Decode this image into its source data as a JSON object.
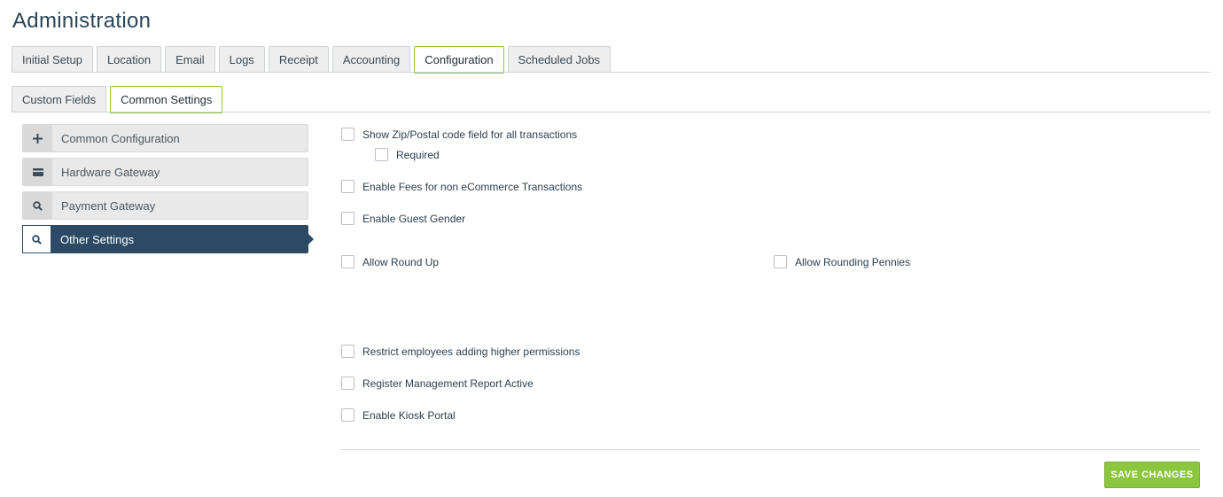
{
  "page": {
    "title": "Administration"
  },
  "main_tabs": [
    {
      "label": "Initial Setup",
      "active": false
    },
    {
      "label": "Location",
      "active": false
    },
    {
      "label": "Email",
      "active": false
    },
    {
      "label": "Logs",
      "active": false
    },
    {
      "label": "Receipt",
      "active": false
    },
    {
      "label": "Accounting",
      "active": false
    },
    {
      "label": "Configuration",
      "active": true
    },
    {
      "label": "Scheduled Jobs",
      "active": false
    }
  ],
  "sub_tabs": [
    {
      "label": "Custom Fields",
      "active": false
    },
    {
      "label": "Common Settings",
      "active": true
    }
  ],
  "side_nav": [
    {
      "label": "Common Configuration",
      "icon": "plus-icon",
      "active": false
    },
    {
      "label": "Hardware Gateway",
      "icon": "card-icon",
      "active": false
    },
    {
      "label": "Payment Gateway",
      "icon": "search-icon",
      "active": false
    },
    {
      "label": "Other Settings",
      "icon": "search-icon",
      "active": true
    }
  ],
  "settings": {
    "show_zip": {
      "label": "Show Zip/Postal code field for all transactions",
      "checked": false
    },
    "required": {
      "label": "Required",
      "checked": false
    },
    "enable_fees": {
      "label": "Enable Fees for non eCommerce Transactions",
      "checked": false
    },
    "guest_gender": {
      "label": "Enable Guest Gender",
      "checked": false
    },
    "round_up": {
      "label": "Allow Round Up",
      "checked": false
    },
    "rounding_pennies": {
      "label": "Allow Rounding Pennies",
      "checked": false
    },
    "restrict_permissions": {
      "label": "Restrict employees adding higher permissions",
      "checked": false
    },
    "register_report": {
      "label": "Register Management Report Active",
      "checked": false
    },
    "kiosk_portal": {
      "label": "Enable Kiosk Portal",
      "checked": false
    }
  },
  "actions": {
    "save_label": "SAVE CHANGES"
  },
  "colors": {
    "accent": "#8cc63f",
    "nav_active": "#2c4a66",
    "title": "#2c4556"
  }
}
